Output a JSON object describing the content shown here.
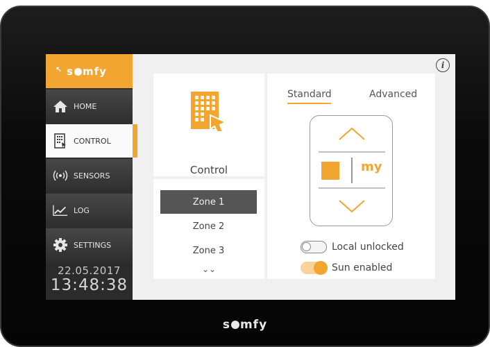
{
  "brand": {
    "name_prefix": "s",
    "name_suffix": "mfy",
    "accent_color": "#f2a531"
  },
  "sidebar": {
    "items": [
      {
        "label": "HOME",
        "icon": "home-icon"
      },
      {
        "label": "CONTROL",
        "icon": "building-icon",
        "active": true
      },
      {
        "label": "SENSORS",
        "icon": "sensor-waves-icon"
      },
      {
        "label": "LOG",
        "icon": "chart-line-icon"
      },
      {
        "label": "SETTINGS",
        "icon": "gear-icon"
      }
    ]
  },
  "datetime": {
    "date": "22.05.2017",
    "time": "13:48:38"
  },
  "control_card": {
    "label": "Control",
    "icon": "building-touch-icon"
  },
  "zones": {
    "items": [
      "Zone 1",
      "Zone 2",
      "Zone 3"
    ],
    "selected": "Zone 1",
    "more_icon": "double-chevron-down-icon"
  },
  "tabs": {
    "standard": "Standard",
    "advanced": "Advanced",
    "selected": "Standard"
  },
  "remote": {
    "my_label": "my",
    "up_icon": "chevron-up-icon",
    "down_icon": "chevron-down-icon",
    "stop_icon": "stop-square-icon"
  },
  "toggles": {
    "local": {
      "label": "Local unlocked",
      "state": "off"
    },
    "sun": {
      "label": "Sun enabled",
      "state": "on"
    }
  },
  "info_icon": "info-icon",
  "bezel_logo": {
    "prefix": "s",
    "suffix": "mfy"
  }
}
